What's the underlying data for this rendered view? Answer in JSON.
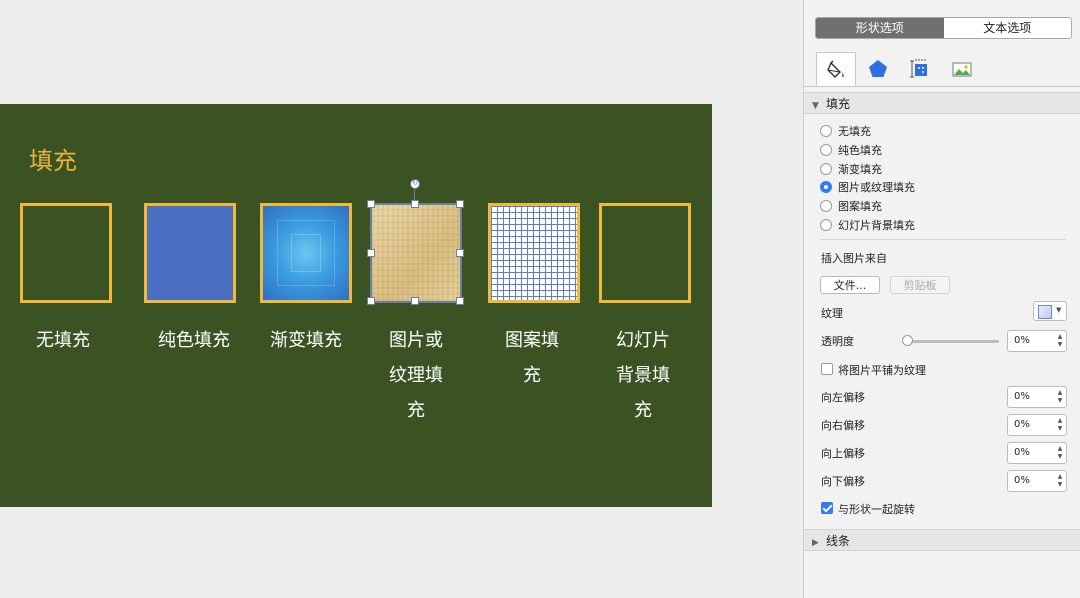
{
  "slide": {
    "title": "填充",
    "shapes": [
      {
        "id": "none",
        "label_lines": [
          "无填充"
        ]
      },
      {
        "id": "solid",
        "label_lines": [
          "纯色填充"
        ]
      },
      {
        "id": "gradient",
        "label_lines": [
          "渐变填充"
        ]
      },
      {
        "id": "picture",
        "label_lines": [
          "图片或",
          "纹理填",
          "充"
        ]
      },
      {
        "id": "pattern",
        "label_lines": [
          "图案填",
          "充"
        ]
      },
      {
        "id": "slidebg",
        "label_lines": [
          "幻灯片",
          "背景填",
          "充"
        ]
      }
    ],
    "colors": {
      "background": "#3b5323",
      "title": "#e8b33a",
      "frame": "#f0b93a"
    }
  },
  "panel": {
    "tabs": {
      "shape_options": "形状选项",
      "text_options": "文本选项"
    },
    "icon_tabs": [
      "paint-bucket-icon",
      "pentagon-icon",
      "size-layout-icon",
      "picture-icon"
    ],
    "fill_section": {
      "title": "填充",
      "options": [
        "无填充",
        "纯色填充",
        "渐变填充",
        "图片或纹理填充",
        "图案填充",
        "幻灯片背景填充"
      ],
      "selected": "图片或纹理填充"
    },
    "insert_from": {
      "label": "插入图片来自",
      "file_button": "文件...",
      "clipboard_button": "剪贴板"
    },
    "texture_label": "纹理",
    "transparency": {
      "label": "透明度",
      "value": "0%"
    },
    "tile_checkbox": {
      "label": "将图片平铺为纹理",
      "checked": false
    },
    "offsets": [
      {
        "label": "向左偏移",
        "value": "0%"
      },
      {
        "label": "向右偏移",
        "value": "0%"
      },
      {
        "label": "向上偏移",
        "value": "0%"
      },
      {
        "label": "向下偏移",
        "value": "0%"
      }
    ],
    "rotate_checkbox": {
      "label": "与形状一起旋转",
      "checked": true
    },
    "line_section": {
      "title": "线条"
    },
    "accent_color": "#2f7cf6"
  }
}
